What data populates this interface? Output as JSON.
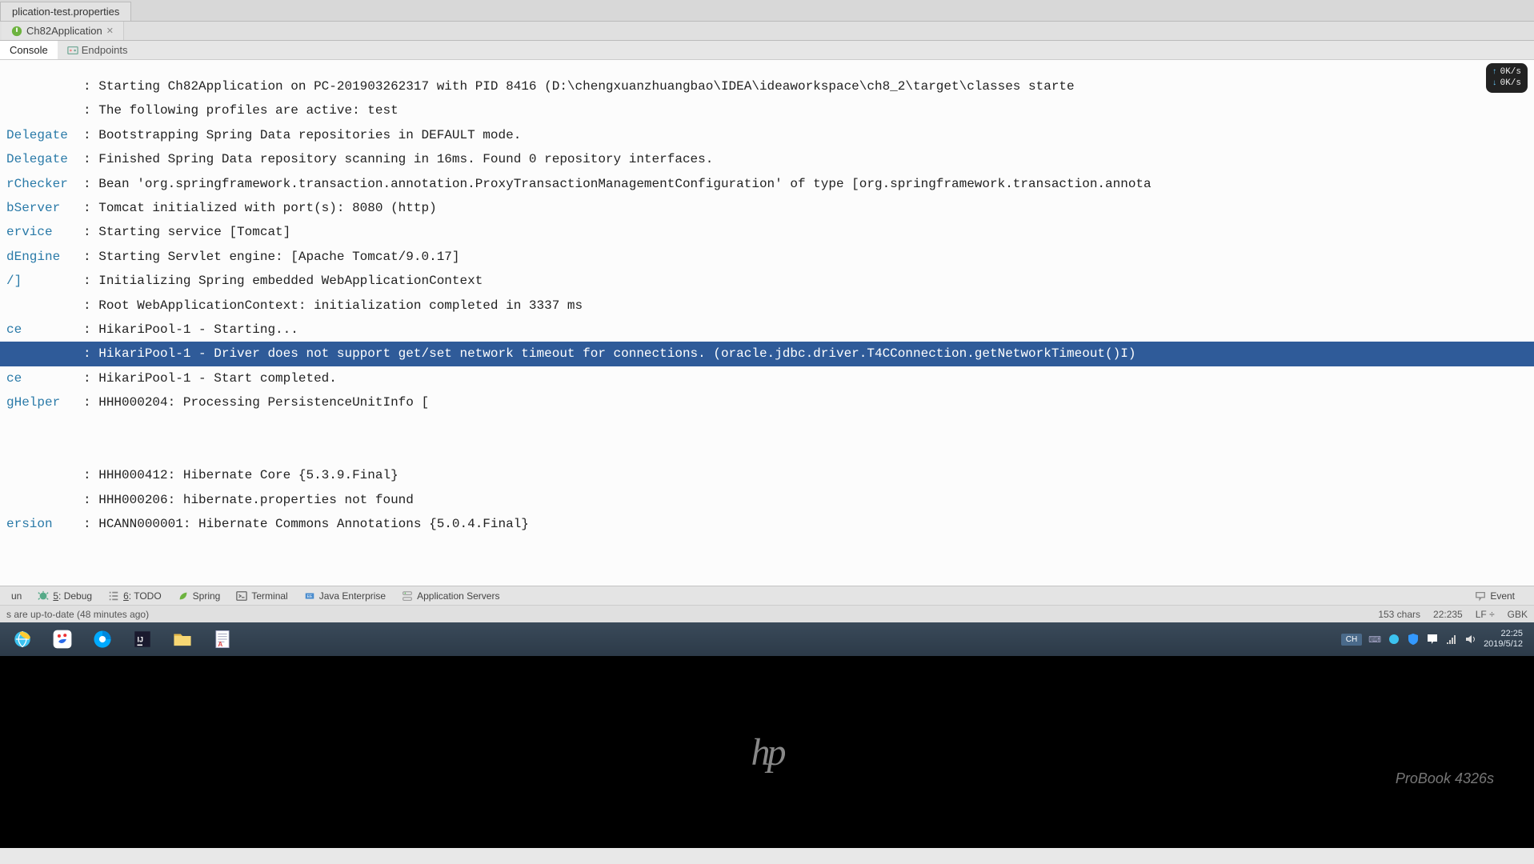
{
  "file_tabs": {
    "tab1": "plication-test.properties"
  },
  "run_tabs": {
    "tab1": "Ch82Application"
  },
  "view_tabs": {
    "console": "Console",
    "endpoints": "Endpoints"
  },
  "net_widget": {
    "up": "0K/s",
    "down": "0K/s"
  },
  "console_lines": [
    {
      "logger": "",
      "text": ": Starting Ch82Application on PC-201903262317 with PID 8416 (D:\\chengxuanzhuangbao\\IDEA\\ideaworkspace\\ch8_2\\target\\classes starte"
    },
    {
      "logger": "",
      "text": ": The following profiles are active: test"
    },
    {
      "logger": "Delegate",
      "text": ": Bootstrapping Spring Data repositories in DEFAULT mode."
    },
    {
      "logger": "Delegate",
      "text": ": Finished Spring Data repository scanning in 16ms. Found 0 repository interfaces."
    },
    {
      "logger": "rChecker",
      "text": ": Bean 'org.springframework.transaction.annotation.ProxyTransactionManagementConfiguration' of type [org.springframework.transaction.annota"
    },
    {
      "logger": "bServer",
      "text": ": Tomcat initialized with port(s): 8080 (http)"
    },
    {
      "logger": "ervice",
      "text": ": Starting service [Tomcat]"
    },
    {
      "logger": "dEngine",
      "text": ": Starting Servlet engine: [Apache Tomcat/9.0.17]"
    },
    {
      "logger": "/]",
      "text": ": Initializing Spring embedded WebApplicationContext"
    },
    {
      "logger": "",
      "text": ": Root WebApplicationContext: initialization completed in 3337 ms"
    },
    {
      "logger": "ce",
      "text": ": HikariPool-1 - Starting..."
    },
    {
      "logger": "",
      "text": ": HikariPool-1 - Driver does not support get/set network timeout for connections. (oracle.jdbc.driver.T4CConnection.getNetworkTimeout()I)",
      "hl": true
    },
    {
      "logger": "ce",
      "text": ": HikariPool-1 - Start completed."
    },
    {
      "logger": "gHelper",
      "text": ": HHH000204: Processing PersistenceUnitInfo ["
    },
    {
      "logger": "",
      "text": ""
    },
    {
      "logger": "",
      "text": ""
    },
    {
      "logger": "",
      "text": ": HHH000412: Hibernate Core {5.3.9.Final}"
    },
    {
      "logger": "",
      "text": ": HHH000206: hibernate.properties not found"
    },
    {
      "logger": "ersion",
      "text": ": HCANN000001: Hibernate Commons Annotations {5.0.4.Final}"
    }
  ],
  "bottom_tools": {
    "run_label": "un",
    "debug_label": "5: Debug",
    "todo_label": "6: TODO",
    "spring_label": "Spring",
    "terminal_label": "Terminal",
    "javaee_label": "Java Enterprise",
    "appservers_label": "Application Servers",
    "event_label": "Event"
  },
  "status_bar": {
    "left": "s are up-to-date (48 minutes ago)",
    "chars": "153 chars",
    "pos": "22:235",
    "lf": "LF",
    "encoding": "GBK"
  },
  "tray": {
    "ime": "CH",
    "time": "22:25",
    "date": "2019/5/12"
  },
  "bezel": {
    "logo": "hp",
    "model": "ProBook 4326s"
  }
}
